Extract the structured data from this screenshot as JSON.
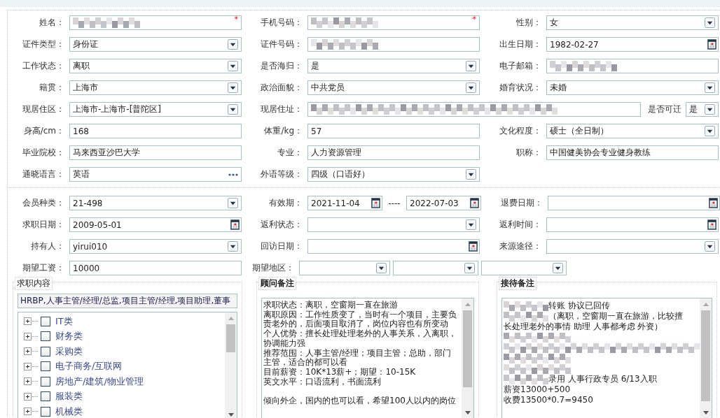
{
  "basic_rows": [
    [
      {
        "label": "姓名：",
        "kind": "text",
        "redacted": true,
        "required_mark": "*"
      },
      {
        "label": "手机号码：",
        "kind": "text",
        "redacted": true,
        "required_mark": "*"
      },
      {
        "label": "性别：",
        "kind": "select",
        "value": "女"
      }
    ],
    [
      {
        "label": "证件类型：",
        "kind": "select",
        "value": "身份证"
      },
      {
        "label": "证件号码：",
        "kind": "text",
        "redacted": true
      },
      {
        "label": "出生日期：",
        "kind": "date",
        "value": "1982-02-27"
      }
    ],
    [
      {
        "label": "工作状态：",
        "kind": "select",
        "value": "离职"
      },
      {
        "label": "是否海归：",
        "kind": "select",
        "value": "是"
      },
      {
        "label": "电子邮箱：",
        "kind": "text",
        "redacted": true
      }
    ],
    [
      {
        "label": "籍贯：",
        "kind": "select",
        "value": "上海市"
      },
      {
        "label": "政治面貌：",
        "kind": "select",
        "value": "中共党员"
      },
      {
        "label": "婚育状况：",
        "kind": "select",
        "value": "未婚"
      }
    ],
    [
      {
        "label": "现居住区：",
        "kind": "select",
        "value": " 上海市-上海市-[普陀区]"
      },
      {
        "label": "现居住址：",
        "kind": "wide_text",
        "redacted": true
      },
      {
        "label": "是否可迁",
        "kind": "small_select",
        "value": "是"
      }
    ],
    [
      {
        "label": "身高/cm：",
        "kind": "text",
        "value": "168"
      },
      {
        "label": "体重/kg：",
        "kind": "text",
        "value": "57"
      },
      {
        "label": "文化程度：",
        "kind": "select",
        "value": "硕士（全日制）"
      }
    ],
    [
      {
        "label": "毕业院校：",
        "kind": "text",
        "value": "马来西亚沙巴大学"
      },
      {
        "label": "专业：",
        "kind": "text",
        "value": "人力资源管理"
      },
      {
        "label": "职称：",
        "kind": "text",
        "value": "中国健美协会专业健身教练"
      }
    ],
    [
      {
        "label": "通晓语言：",
        "kind": "lookup",
        "value": "英语"
      },
      {
        "label": "外语等级：",
        "kind": "select",
        "value": "四级（口语好）"
      }
    ]
  ],
  "member_rows": [
    [
      {
        "label": "会员种类：",
        "kind": "select",
        "value": " 21-498"
      },
      {
        "label": "有效期：",
        "kind": "date_range",
        "values": [
          "2021-11-04",
          "2022-07-03"
        ],
        "separator": "----"
      },
      {
        "label": "退费日期：",
        "kind": "date"
      }
    ],
    [
      {
        "label": "求职日期：",
        "kind": "date",
        "value": "2009-05-01"
      },
      {
        "label": "返利状态：",
        "kind": "select"
      },
      {
        "label": "返利时间：",
        "kind": "date"
      }
    ],
    [
      {
        "label": "持有人：",
        "kind": "select",
        "value": "yirui010"
      },
      {
        "label": "回访日期：",
        "kind": "date"
      },
      {
        "label": "来源途径：",
        "kind": "select"
      }
    ],
    [
      {
        "label": "期望工资：",
        "kind": "text",
        "value": "10000"
      },
      {
        "label": "期望地区：",
        "kind": "region_selects"
      }
    ]
  ],
  "job_panel": {
    "legend": "求职内容",
    "summary": "HRBP,人事主管/经理/总监,项目主管/经理,项目助理,董事",
    "categories": [
      {
        "label": "IT类",
        "checked": false
      },
      {
        "label": "财务类",
        "checked": false
      },
      {
        "label": "采购类",
        "checked": false
      },
      {
        "label": "电子商务/互联网",
        "checked": false
      },
      {
        "label": "房地产/建筑/物业管理",
        "checked": false
      },
      {
        "label": "服装类",
        "checked": false
      },
      {
        "label": "机械类",
        "checked": false
      }
    ]
  },
  "advisor_panel": {
    "legend": "顾问备注",
    "paragraphs": [
      [
        "求职状态：离职，空窗期一直在旅游",
        "离职原因：工作性质变了，当时有一个项目，主要负",
        "责老外的，后面项目取消了，岗位内容也有所变动",
        "个人优势：擅长处理处理老外的人事关系，入离职，",
        "协调能力强",
        "推荐范围：人事主管/经理；项目主管；总助，部门",
        "主管，适合的都可以看",
        "目前薪资：10K*13薪+；期望：10-15K",
        "英文水平：口语流利，书面流利"
      ],
      [
        "倾向外企，国内的也可以看，希望100人以内的岗位"
      ]
    ]
  },
  "reception_panel": {
    "legend": "接待备注",
    "lines": [
      {
        "kind": "text",
        "masked_prefix": true,
        "text": " 转账 协议已回传"
      },
      {
        "kind": "text",
        "masked_prefix": true,
        "text": "（离职，空窗期一直在旅游，比较擅"
      },
      {
        "kind": "text",
        "masked_prefix": false,
        "text": "长处理老外的事情  助理 人事都考虑  外资）"
      },
      {
        "kind": "masked"
      },
      {
        "kind": "masked"
      },
      {
        "kind": "masked"
      },
      {
        "kind": "masked"
      },
      {
        "kind": "text",
        "masked_prefix": true,
        "text": "录用 人事行政专员 6/13入职"
      },
      {
        "kind": "text",
        "masked_prefix": false,
        "text": "薪资13000+500"
      },
      {
        "kind": "text",
        "masked_prefix": false,
        "text": "收费13500*0.7=9450"
      }
    ]
  }
}
